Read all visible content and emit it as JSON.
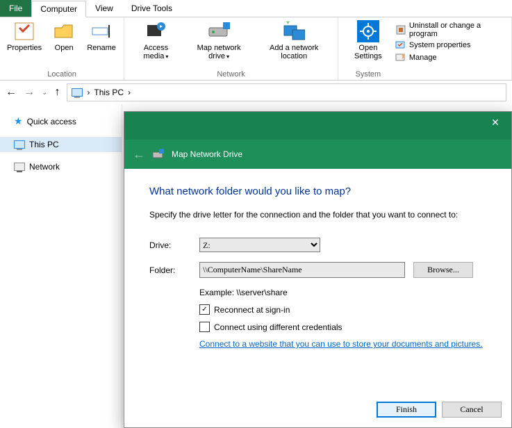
{
  "tabs": {
    "file": "File",
    "computer": "Computer",
    "view": "View",
    "drive_tools": "Drive Tools"
  },
  "ribbon": {
    "location": {
      "title": "Location",
      "properties": "Properties",
      "open": "Open",
      "rename": "Rename"
    },
    "network": {
      "title": "Network",
      "access_media": "Access media",
      "map_drive": "Map network drive",
      "add_location": "Add a network location"
    },
    "system": {
      "title": "System",
      "open_settings": "Open Settings",
      "uninstall": "Uninstall or change a program",
      "properties": "System properties",
      "manage": "Manage"
    }
  },
  "breadcrumb": {
    "root": "This PC",
    "sep": "›"
  },
  "sidebar": {
    "quick_access": "Quick access",
    "this_pc": "This PC",
    "network": "Network"
  },
  "dialog": {
    "title": "Map Network Drive",
    "question": "What network folder would you like to map?",
    "subtitle": "Specify the drive letter for the connection and the folder that you want to connect to:",
    "drive_label": "Drive:",
    "drive_value": "Z:",
    "folder_label": "Folder:",
    "folder_value": "\\\\ComputerName\\ShareName",
    "browse": "Browse...",
    "example": "Example: \\\\server\\share",
    "reconnect": "Reconnect at sign-in",
    "credentials": "Connect using different credentials",
    "link": "Connect to a website that you can use to store your documents and pictures.",
    "finish": "Finish",
    "cancel": "Cancel"
  }
}
